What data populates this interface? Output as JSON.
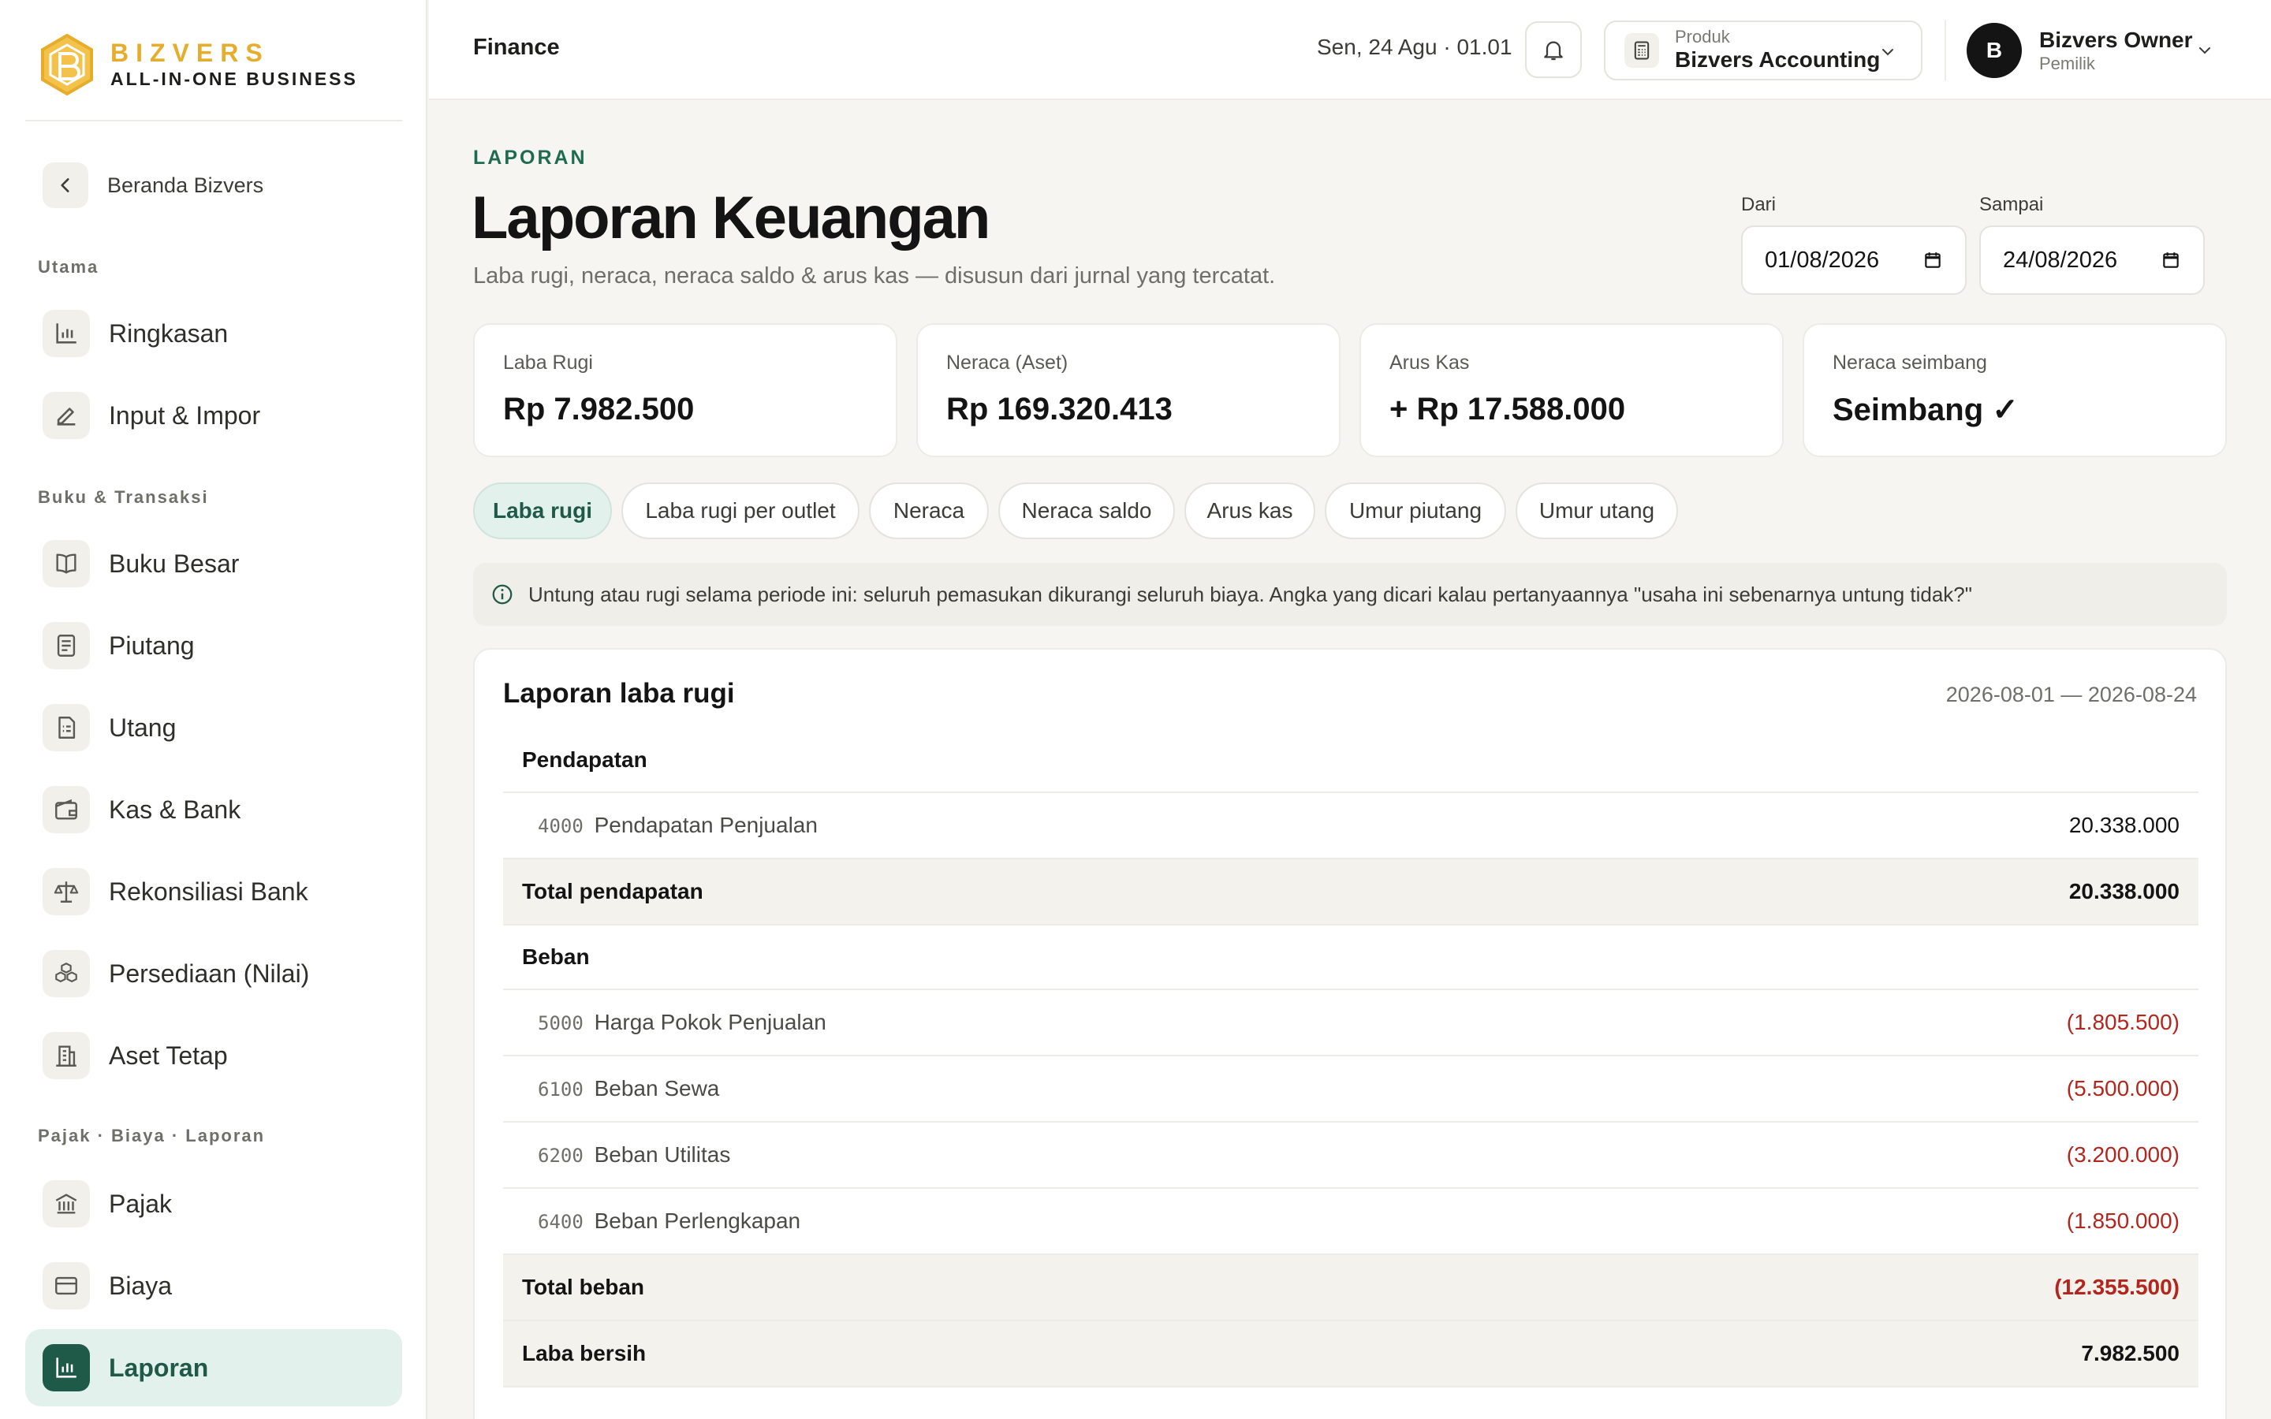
{
  "brand": {
    "name": "BIZVERS",
    "tagline": "ALL-IN-ONE BUSINESS"
  },
  "sidebar": {
    "back_label": "Beranda Bizvers",
    "sections": {
      "utama": "Utama",
      "buku": "Buku & Transaksi",
      "pajak": "Pajak · Biaya · Laporan"
    },
    "items": {
      "ringkasan": "Ringkasan",
      "input": "Input & Impor",
      "buku_besar": "Buku Besar",
      "piutang": "Piutang",
      "utang": "Utang",
      "kas_bank": "Kas & Bank",
      "rekonsiliasi": "Rekonsiliasi Bank",
      "persediaan": "Persediaan (Nilai)",
      "aset": "Aset Tetap",
      "pajak": "Pajak",
      "biaya": "Biaya",
      "laporan": "Laporan"
    },
    "active_item": "Laporan"
  },
  "topbar": {
    "title": "Finance",
    "datetime": "Sen, 24 Agu · 01.01",
    "product_caption": "Produk",
    "product_name": "Bizvers Accounting",
    "user_initial": "B",
    "user_name": "Bizvers Owner",
    "user_role": "Pemilik"
  },
  "page": {
    "eyebrow": "LAPORAN",
    "title": "Laporan Keuangan",
    "subtitle": "Laba rugi, neraca, neraca saldo & arus kas — disusun dari jurnal yang tercatat.",
    "date_from_label": "Dari",
    "date_from": "01/08/2026",
    "date_to_label": "Sampai",
    "date_to": "24/08/2026"
  },
  "stats": {
    "laba_rugi": {
      "label": "Laba Rugi",
      "value": "Rp 7.982.500"
    },
    "neraca": {
      "label": "Neraca (Aset)",
      "value": "Rp 169.320.413"
    },
    "arus_kas": {
      "label": "Arus Kas",
      "value": "+ Rp 17.588.000"
    },
    "seimbang": {
      "label": "Neraca seimbang",
      "value": "Seimbang ✓"
    }
  },
  "tabs": {
    "laba_rugi": "Laba rugi",
    "per_outlet": "Laba rugi per outlet",
    "neraca": "Neraca",
    "neraca_saldo": "Neraca saldo",
    "arus_kas": "Arus kas",
    "umur_piutang": "Umur piutang",
    "umur_utang": "Umur utang",
    "active": "Laba rugi"
  },
  "info": "Untung atau rugi selama periode ini: seluruh pemasukan dikurangi seluruh biaya. Angka yang dicari kalau pertanyaannya \"usaha ini sebenarnya untung tidak?\"",
  "report": {
    "title": "Laporan laba rugi",
    "range": "2026-08-01 — 2026-08-24",
    "pendapatan_heading": "Pendapatan",
    "pendapatan": [
      {
        "code": "4000",
        "name": "Pendapatan Penjualan",
        "amount": "20.338.000"
      }
    ],
    "total_pendapatan_label": "Total pendapatan",
    "total_pendapatan": "20.338.000",
    "beban_heading": "Beban",
    "beban": [
      {
        "code": "5000",
        "name": "Harga Pokok Penjualan",
        "amount": "(1.805.500)"
      },
      {
        "code": "6100",
        "name": "Beban Sewa",
        "amount": "(5.500.000)"
      },
      {
        "code": "6200",
        "name": "Beban Utilitas",
        "amount": "(3.200.000)"
      },
      {
        "code": "6400",
        "name": "Beban Perlengkapan",
        "amount": "(1.850.000)"
      }
    ],
    "total_beban_label": "Total beban",
    "total_beban": "(12.355.500)",
    "laba_bersih_label": "Laba bersih",
    "laba_bersih": "7.982.500"
  },
  "colors": {
    "accent": "#1f5a48",
    "accent_soft": "#e3f1ec",
    "brand_gold": "#e6ad2c",
    "negative": "#b3261e",
    "background": "#f6f5f1"
  }
}
